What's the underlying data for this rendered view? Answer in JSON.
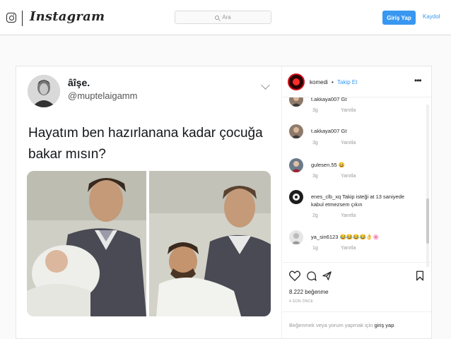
{
  "nav": {
    "logo": "Instagram",
    "search_placeholder": "Ara",
    "login_label": "Giriş Yap",
    "signup_label": "Kaydol"
  },
  "tweet": {
    "name": "âîşe.",
    "handle": "@muptelaigamm",
    "text": "Hayatım ben hazırlanana kadar çocuğa bakar mısın?"
  },
  "post": {
    "username": "komedi",
    "dot": "•",
    "follow_label": "Takip Et",
    "more_label": "•••",
    "likes": "8.222 beğenme",
    "time_ago": "4 GÜN ÖNCE",
    "footer_prefix": "Beğenmek veya yorum yapmak için ",
    "footer_link": "giriş yap",
    "footer_suffix": "."
  },
  "comments": [
    {
      "text": "t.akkaya007 Gt",
      "age": "3g",
      "reply": "Yanıtla"
    },
    {
      "text": "t.akkaya007 Gt",
      "age": "3g",
      "reply": "Yanıtla"
    },
    {
      "text": "gulesen.55 😀",
      "age": "3g",
      "reply": "Yanıtla"
    },
    {
      "text": "enes_clb_xq Takip isteği at 13 saniyede kabul etmezsem çıkın",
      "age": "2g",
      "reply": "Yanıtla"
    },
    {
      "text": "ya_sin6123 😂😂😂😂👌🌸",
      "age": "1g",
      "reply": "Yanıtla"
    }
  ],
  "colors": {
    "accent": "#3897f0",
    "text": "#262626",
    "muted": "#999999"
  }
}
